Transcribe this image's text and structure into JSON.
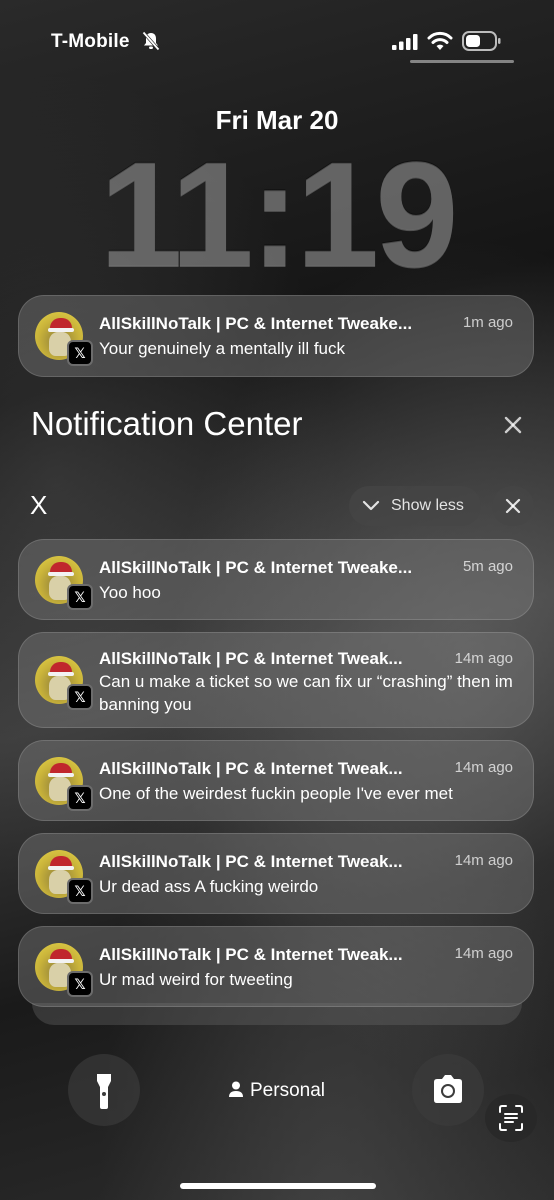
{
  "status_bar": {
    "carrier": "T-Mobile"
  },
  "lock_screen": {
    "date": "Fri Mar 20",
    "time": "11:19"
  },
  "top_notification": {
    "title": "AllSkillNoTalk | PC & Internet Tweake...",
    "time": "1m ago",
    "body": "Your genuinely a mentally ill fuck",
    "app_badge": "𝕏"
  },
  "notification_center": {
    "title": "Notification Center"
  },
  "group": {
    "label": "X",
    "show_less_label": "Show less",
    "notifications": [
      {
        "title": "AllSkillNoTalk | PC & Internet Tweake...",
        "time": "5m ago",
        "body": "Yoo hoo"
      },
      {
        "title": "AllSkillNoTalk | PC & Internet Tweak...",
        "time": "14m ago",
        "body": "Can u make a ticket so we can fix ur “crashing” then im banning you"
      },
      {
        "title": "AllSkillNoTalk | PC & Internet Tweak...",
        "time": "14m ago",
        "body": "One of the weirdest fuckin people I've ever met"
      },
      {
        "title": "AllSkillNoTalk | PC & Internet Tweak...",
        "time": "14m ago",
        "body": "Ur dead ass A fucking weirdo"
      },
      {
        "title": "AllSkillNoTalk | PC & Internet Tweak...",
        "time": "14m ago",
        "body": "Ur mad weird for tweeting"
      }
    ]
  },
  "bottom": {
    "focus_label": "Personal"
  },
  "icons": {
    "mute": "bell-slash-icon",
    "signal": "cellular-signal-icon",
    "wifi": "wifi-icon",
    "battery": "battery-icon",
    "flashlight": "flashlight-icon",
    "camera": "camera-icon",
    "text_scan": "text-scan-icon",
    "person": "person-icon"
  }
}
